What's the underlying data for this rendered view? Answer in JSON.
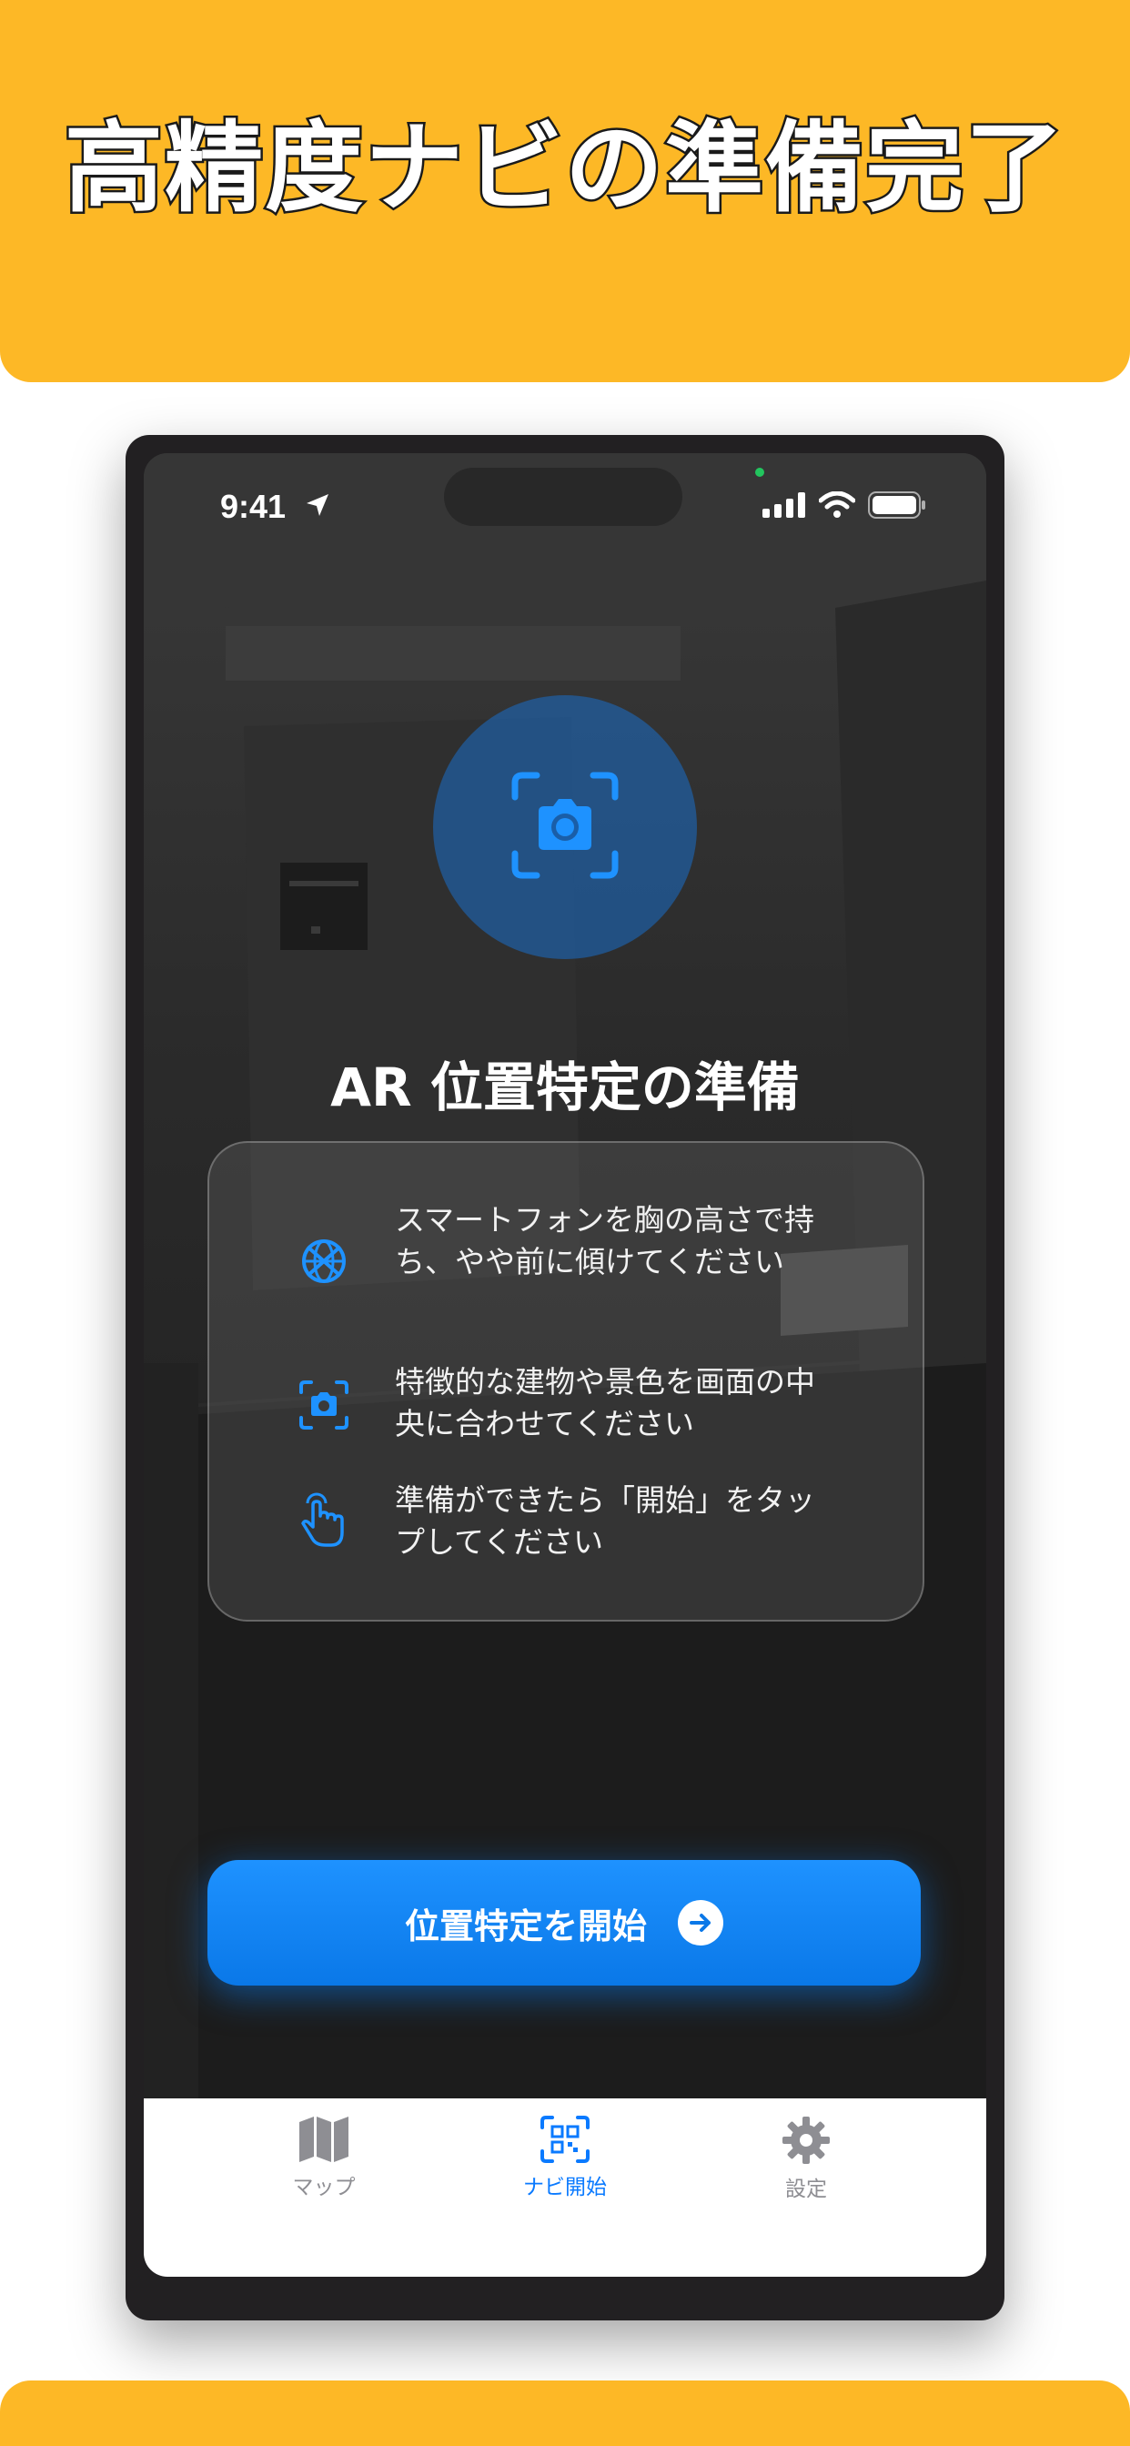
{
  "banner": {
    "headline": "高精度ナビの準備完了"
  },
  "status_bar": {
    "time": "9:41"
  },
  "screen": {
    "title": "AR 位置特定の準備",
    "steps": [
      {
        "icon": "compass-globe-icon",
        "text": "スマートフォンを胸の高さで持ち、やや前に傾けてください"
      },
      {
        "icon": "camera-frame-icon",
        "text": "特徴的な建物や景色を画面の中央に合わせてください"
      },
      {
        "icon": "tap-hand-icon",
        "text": "準備ができたら「開始」をタップしてください"
      }
    ],
    "start_button": "位置特定を開始"
  },
  "tabbar": {
    "items": [
      {
        "label": "マップ",
        "icon": "map-icon",
        "active": false
      },
      {
        "label": "ナビ開始",
        "icon": "qr-scan-icon",
        "active": true
      },
      {
        "label": "設定",
        "icon": "gear-icon",
        "active": false
      }
    ]
  },
  "colors": {
    "banner": "#FDB826",
    "accent": "#0A7AFF",
    "tab_inactive": "#8E8E93"
  }
}
